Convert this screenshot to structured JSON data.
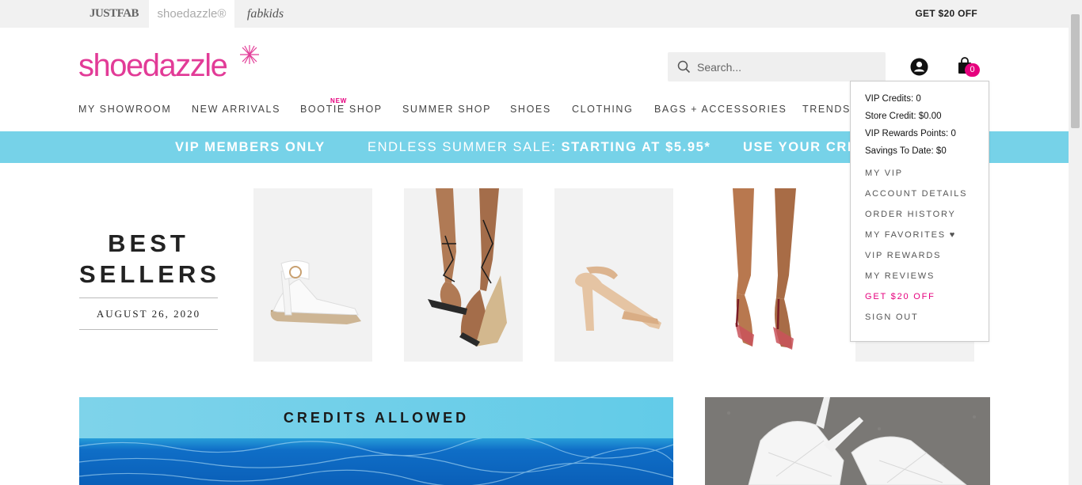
{
  "brandbar": {
    "brands": [
      "JUSTFAB",
      "shoedazzle®",
      "fabkids"
    ],
    "promo": "GET $20 OFF"
  },
  "header": {
    "logo": "shoedazzle",
    "search_placeholder": "Search...",
    "cart_count": "0"
  },
  "nav": {
    "items": [
      "MY SHOWROOM",
      "NEW ARRIVALS",
      "BOOTIE SHOP",
      "SUMMER SHOP",
      "SHOES",
      "CLOTHING",
      "BAGS + ACCESSORIES",
      "TRENDS"
    ],
    "new_badge": "NEW"
  },
  "banner": {
    "vip": "VIP MEMBERS ONLY",
    "sale_prefix": "ENDLESS SUMMER SALE: ",
    "sale_bold": "STARTING AT $5.95*",
    "credits": "USE YOUR CREDITS"
  },
  "best_sellers": {
    "title_line1": "BEST",
    "title_line2": "SELLERS",
    "date": "AUGUST 26, 2020"
  },
  "promos": {
    "credits_title": "CREDITS ALLOWED"
  },
  "account_dropdown": {
    "vip_credits": "VIP Credits: 0",
    "store_credit": "Store Credit: $0.00",
    "reward_points": "VIP Rewards Points: 0",
    "savings": "Savings To Date: $0",
    "links": [
      "MY VIP",
      "ACCOUNT DETAILS",
      "ORDER HISTORY",
      "MY FAVORITES ♥",
      "VIP REWARDS",
      "MY REVIEWS",
      "GET $20 OFF",
      "SIGN OUT"
    ]
  },
  "colors": {
    "brand_pink": "#e23b97",
    "accent_pink": "#e6007e",
    "banner_blue": "#76d2e8"
  }
}
